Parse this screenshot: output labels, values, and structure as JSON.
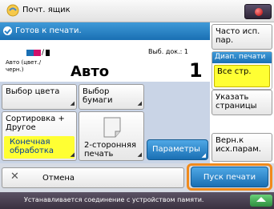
{
  "topbar": {
    "title": "Почт. ящик",
    "icon": "mailbox-icon",
    "right_icon": "counter-check-icon"
  },
  "status": {
    "icon": "ready-check-icon",
    "text": "Готов к печати."
  },
  "buttons": {
    "frequent": "Часто исп. пар.",
    "color_select": "Выбор цвета",
    "paper_select": "Выбор бумаги",
    "sort_top": "Сортировка + Другое",
    "sort_bottom": "Конечная обработка",
    "duplex": "2-сторонняя печать",
    "params": "Параметры",
    "restore": "Верн.к исх.парам.",
    "specify_pages": "Указать страницы",
    "cancel": "Отмена",
    "start": "Пуск печати"
  },
  "job": {
    "color_label": "Авто (цвет./черн.)",
    "mode_value": "Авто",
    "copies_label": "Выб. док.: 1",
    "copies_value": "1"
  },
  "range": {
    "header": "Диап. печати",
    "selected": "Все стр."
  },
  "footer": {
    "text": "Устанавливается соединение с устройством памяти."
  },
  "colors": {
    "accent": "#1a6fb3",
    "highlight": "#f08a1c",
    "selection": "#ffff33"
  }
}
